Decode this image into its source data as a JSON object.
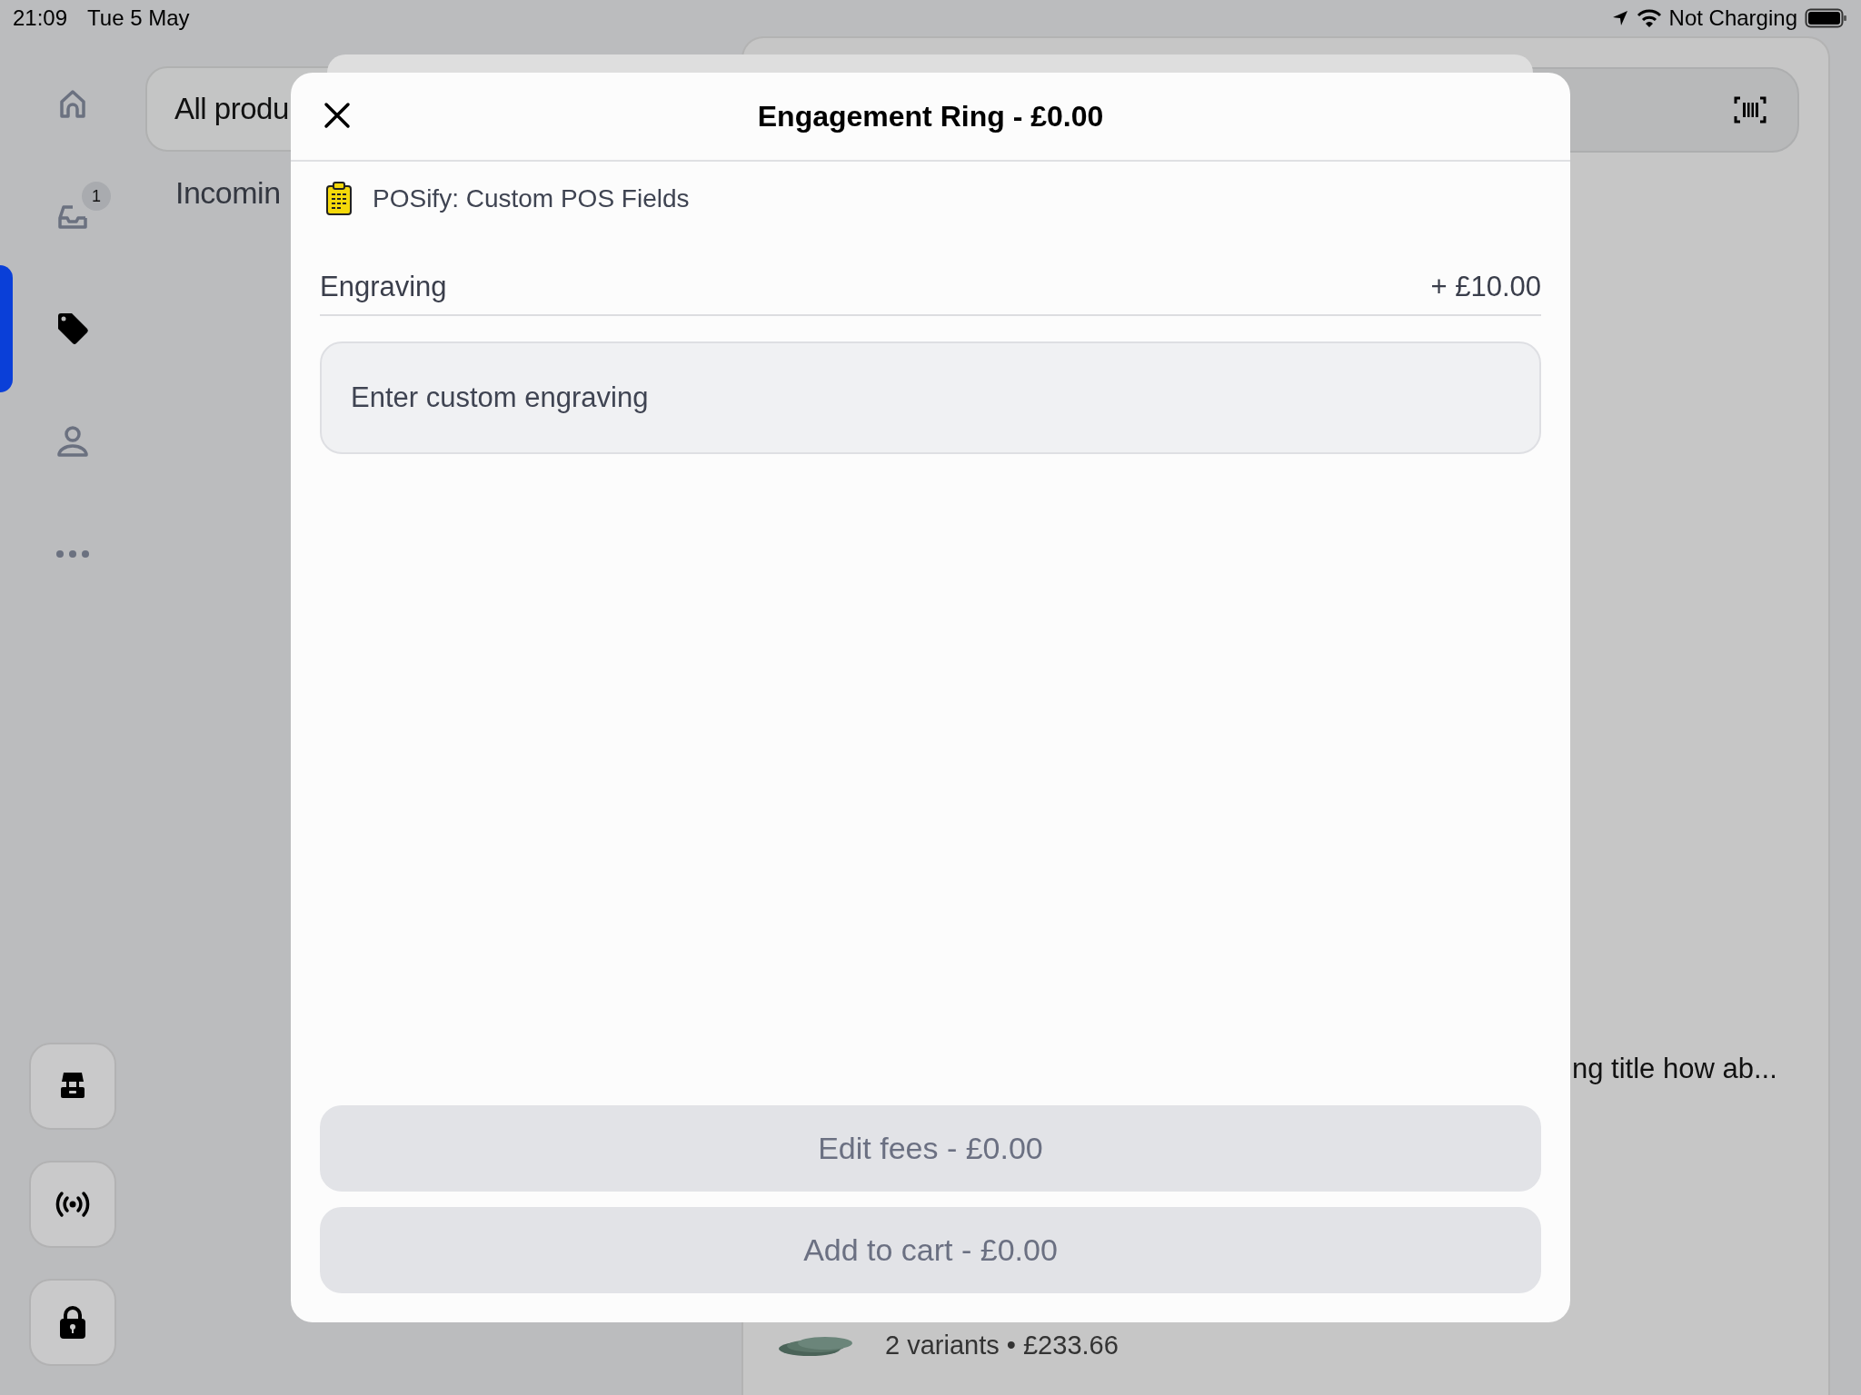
{
  "status_bar": {
    "time": "21:09",
    "date": "Tue 5 May",
    "battery_text": "Not Charging"
  },
  "sidebar": {
    "items": [
      {
        "selected": false
      },
      {
        "selected": false,
        "badge": "1"
      },
      {
        "selected": true
      },
      {
        "selected": false
      },
      {
        "selected": false
      }
    ]
  },
  "background": {
    "search_label": "All produ",
    "section_title": "Incomin",
    "list_item_title": "ng title how ab...",
    "list_item_subtitle": "2 variants • £233.66"
  },
  "modal": {
    "title": "Engagement Ring - £0.00",
    "app_name": "POSify: Custom POS Fields",
    "field": {
      "label": "Engraving",
      "price": "+ £10.00",
      "placeholder": "Enter custom engraving"
    },
    "buttons": [
      {
        "label": "Edit fees - £0.00",
        "disabled": true
      },
      {
        "label": "Add to cart - £0.00",
        "disabled": true
      }
    ]
  }
}
